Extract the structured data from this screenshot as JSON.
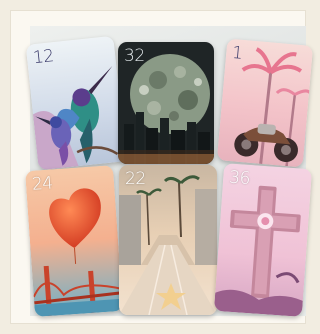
{
  "cards": [
    {
      "id": "c12",
      "number": "12",
      "image": "hummingbirds"
    },
    {
      "id": "c32",
      "number": "32",
      "image": "moon-over-city"
    },
    {
      "id": "c1",
      "number": "1",
      "image": "palm-trees-motorcycle"
    },
    {
      "id": "c24",
      "number": "24",
      "image": "heart-balloon-golden-gate"
    },
    {
      "id": "c22",
      "number": "22",
      "image": "palm-boulevard-star"
    },
    {
      "id": "c36",
      "number": "36",
      "image": "ornate-cross"
    }
  ]
}
